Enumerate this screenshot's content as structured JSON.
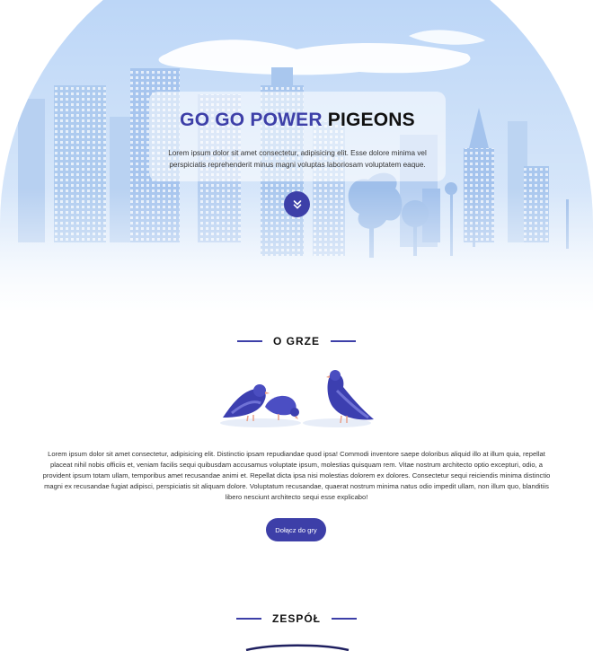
{
  "hero": {
    "title_accent": "GO GO POWER",
    "title_main": "PIGEONS",
    "subtitle": "Lorem ipsum dolor sit amet consectetur, adipisicing elit. Esse dolore minima vel perspiciatis reprehenderit minus magni voluptas laboriosam voluptatem eaque.",
    "scroll_icon": "double-chevron-down-icon"
  },
  "about": {
    "heading": "O GRZE",
    "text": "Lorem ipsum dolor sit amet consectetur, adipisicing elit. Distinctio ipsam repudiandae quod ipsa! Commodi inventore saepe doloribus aliquid illo at illum quia, repellat placeat nihil nobis officiis et, veniam facilis sequi quibusdam accusamus voluptate ipsum, molestias quisquam rem. Vitae nostrum architecto optio excepturi, odio, a provident ipsum totam ullam, temporibus amet recusandae animi et. Repellat dicta ipsa nisi molestias dolorem ex dolores. Consectetur sequi reiciendis minima distinctio magni ex recusandae fugiat adipisci, perspiciatis sit aliquam dolore. Voluptatum recusandae, quaerat nostrum minima natus odio impedit ullam, non illum quo, blanditiis libero nesciunt architecto sequi esse explicabo!",
    "join_button": "Dołącz do gry"
  },
  "team": {
    "heading": "ZESPÓŁ"
  },
  "colors": {
    "accent": "#3d3fa8",
    "sky": "#c9ddf5",
    "building": "#a9c7ee"
  }
}
